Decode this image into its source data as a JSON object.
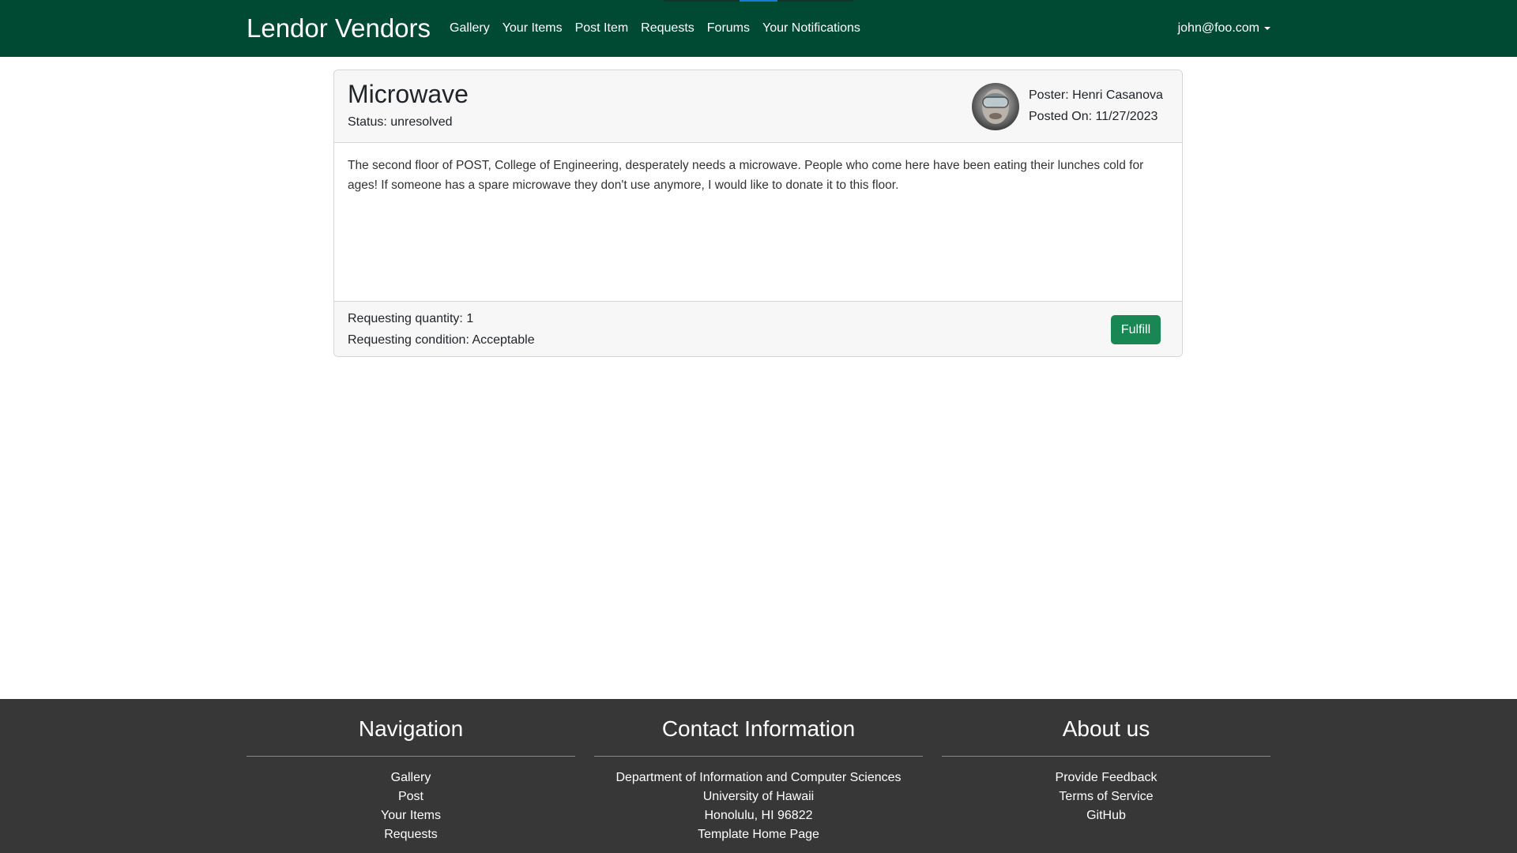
{
  "navbar": {
    "brand": "Lendor Vendors",
    "links": [
      "Gallery",
      "Your Items",
      "Post Item",
      "Requests",
      "Forums",
      "Your Notifications"
    ],
    "user": "john@foo.com",
    "background": "#004a33"
  },
  "request": {
    "title": "Microwave",
    "status": "Status: unresolved",
    "poster": "Poster: Henri Casanova",
    "posted_on": "Posted On: 11/27/2023",
    "description": "The second floor of POST, College of Engineering, desperately needs a microwave. People who come here have been eating their lunches cold for ages! If someone has a spare microwave they don't use anymore, I would like to donate it to this floor.",
    "quantity": "Requesting quantity: 1",
    "condition": "Requesting condition: Acceptable",
    "fulfill_label": "Fulfill",
    "button_color": "#198754"
  },
  "footer": {
    "navigation": {
      "title": "Navigation",
      "items": [
        "Gallery",
        "Post",
        "Your Items",
        "Requests"
      ]
    },
    "contact": {
      "title": "Contact Information",
      "items": [
        "Department of Information and Computer Sciences",
        "University of Hawaii",
        "Honolulu, HI 96822",
        "Template Home Page"
      ]
    },
    "about": {
      "title": "About us",
      "items": [
        "Provide Feedback",
        "Terms of Service",
        "GitHub"
      ]
    },
    "background": "#373737"
  }
}
